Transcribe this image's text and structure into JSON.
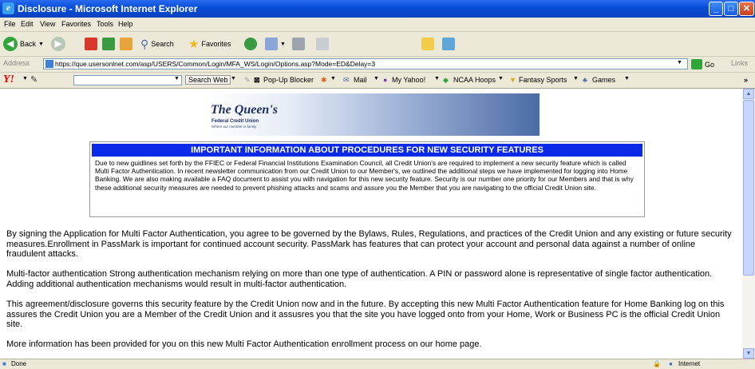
{
  "window": {
    "title": "Disclosure - Microsoft Internet Explorer"
  },
  "menu": {
    "items": [
      "File",
      "Edit",
      "View",
      "Favorites",
      "Tools",
      "Help"
    ]
  },
  "toolbar": {
    "back": "Back",
    "search": "Search",
    "favorites": "Favorites"
  },
  "address": {
    "label": "Address",
    "url": "https://que.usersonlnet.com/asp/USERS/Common/Login/MFA_WS/Login/Options.asp?Mode=ED&Delay=3",
    "go": "Go",
    "links": "Links"
  },
  "yahoo": {
    "search_web": "Search Web",
    "popup_blocker": "Pop-Up Blocker",
    "mail": "Mail",
    "my_yahoo": "My Yahoo!",
    "ncaa": "NCAA Hoops",
    "fantasy": "Fantasy Sports",
    "games": "Games"
  },
  "logo": {
    "name": "The Queen's",
    "sub": "Federal Credit Union",
    "tag": "Where our member is family"
  },
  "notice": {
    "heading": "IMPORTANT INFORMATION ABOUT PROCEDURES FOR NEW SECURITY FEATURES",
    "body": "Due to new guidlines set forth by the FFIEC or Federal Financial Institutions Examination Council, all Credit Union's are required to implement a new security feature which is called Multi Factor Authentication. In recent newsletter communication from our Credit Union to our Member's, we outlined the additional steps we have implemented for logging into Home Banking. We are also making available a FAQ document to assist you with navigation for this new security feature. Security is our number one priority for our Members and that is why these additional security measures are needed to prevent phishing attacks and scams and assure you the Member that you are navigating to the official Credit Union site."
  },
  "paragraphs": [
    "By signing the Application for Multi Factor Authentication, you agree to be governed by the Bylaws, Rules, Regulations, and practices of the Credit Union and any existing or future security measures.Enrollment in PassMark is important for continued account security. PassMark has features that can protect your account and personal data against a number of online fraudulent attacks.",
    "Multi-factor authentication Strong authentication mechanism relying on more than one type of authentication. A PIN or password alone is representative of single factor authentication. Adding additional authentication mechanisms would result in multi-factor authentication.",
    "This agreement/disclosure governs this security feature by the Credit Union now and in the future. By accepting this new Multi Factor Authentication feature for Home Banking log on this assures the Credit Union you are a Member of the Credit Union and it assusres you that the site you have logged onto from your Home, Work or Business PC is the official Credit Union site.",
    "More information has been provided for you on this new Multi Factor Authentication enrollment process on our home page."
  ],
  "status": {
    "left": "Done",
    "zone": "Internet"
  }
}
